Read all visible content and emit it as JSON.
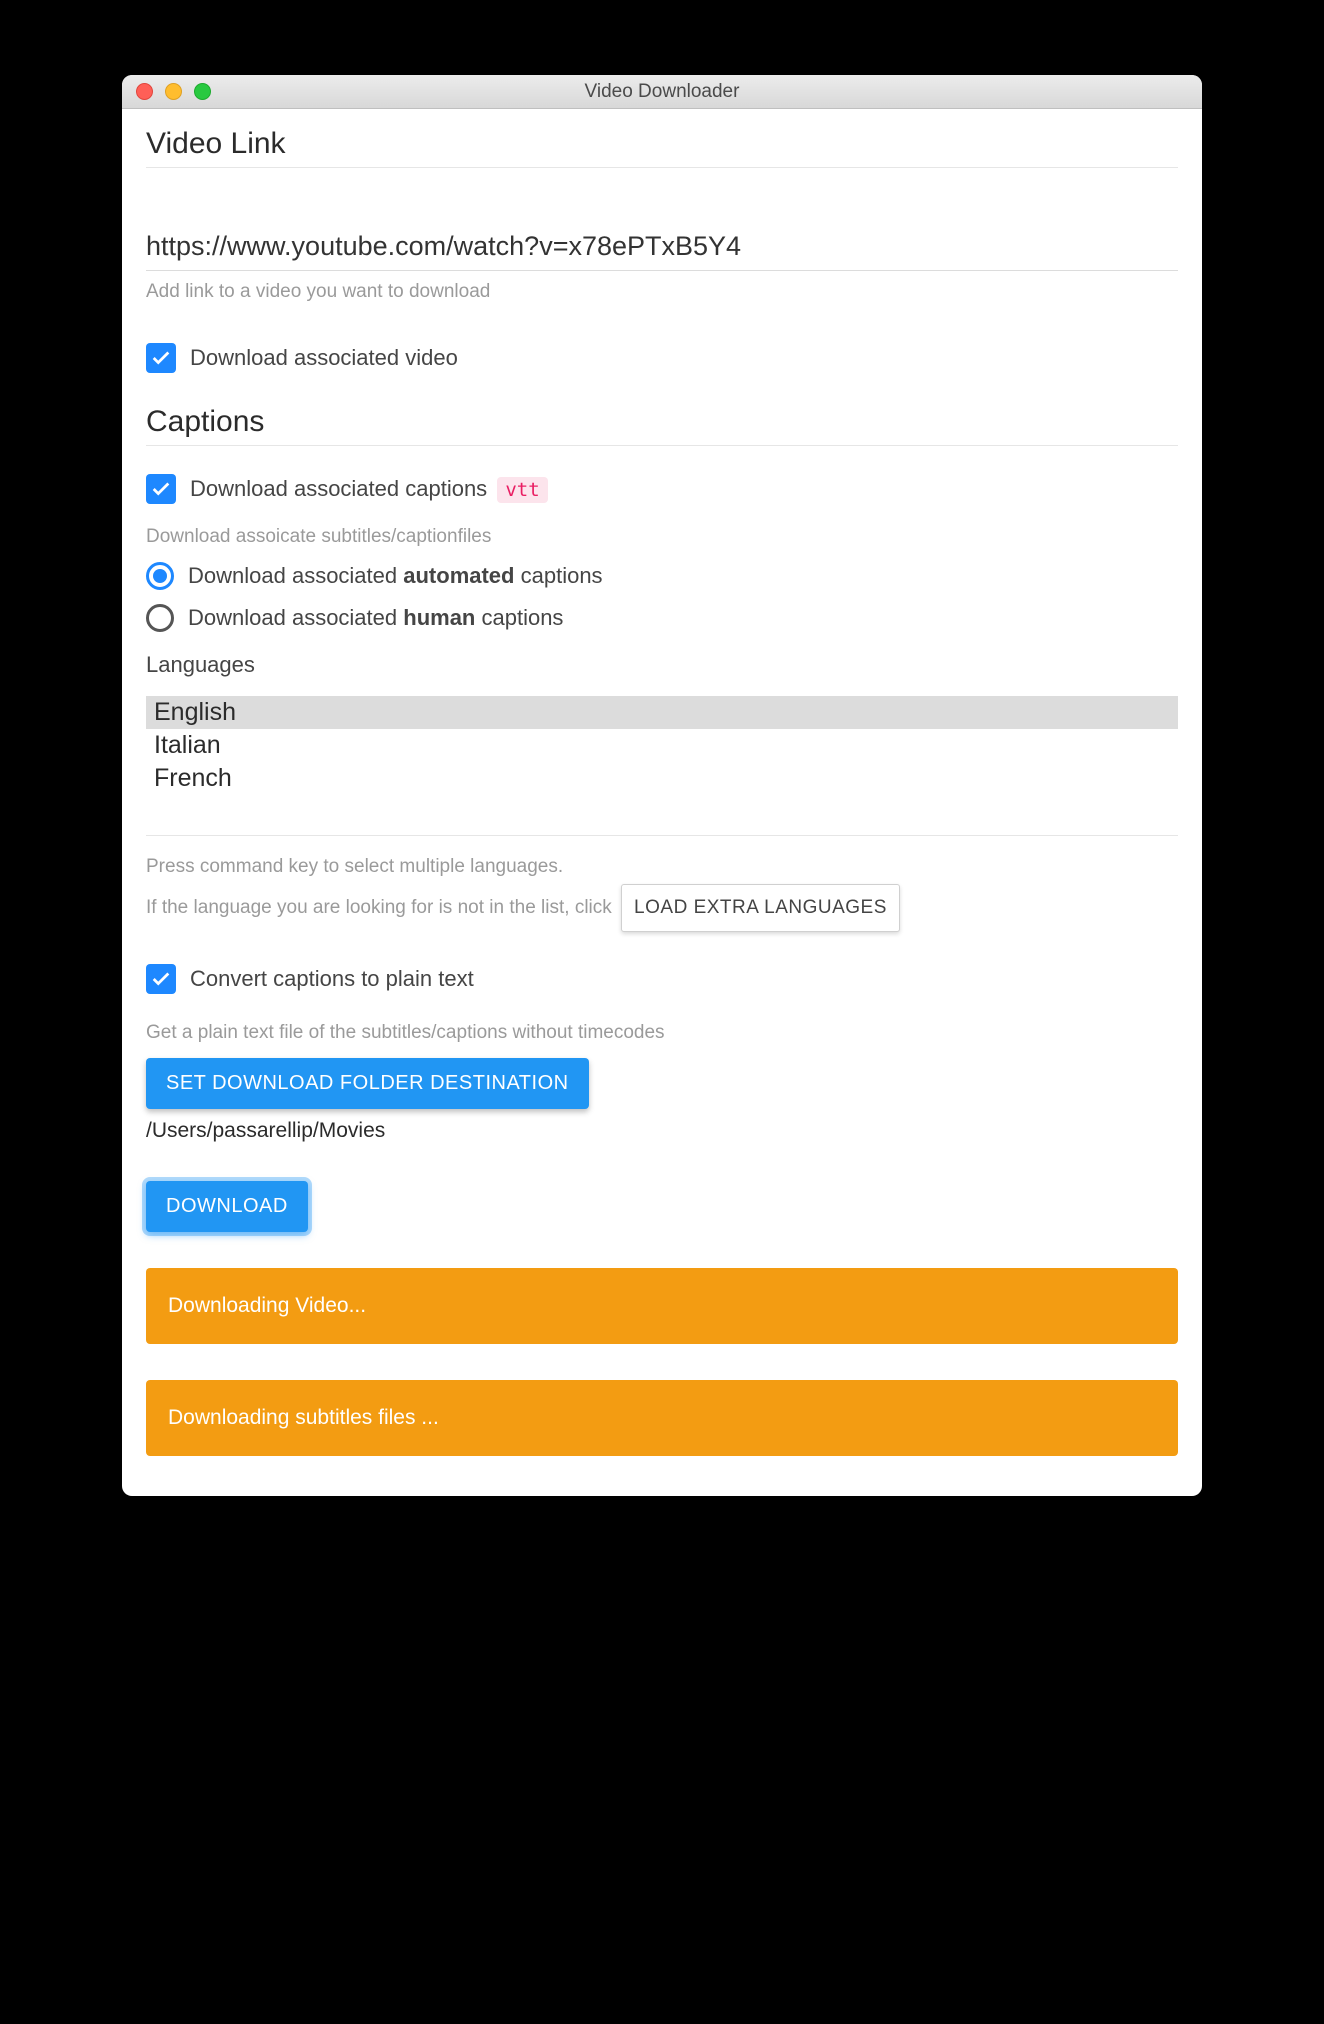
{
  "window": {
    "title": "Video Downloader"
  },
  "videoLink": {
    "heading": "Video Link",
    "url": "https://www.youtube.com/watch?v=x78ePTxB5Y4",
    "helper": "Add link to a video you want to download"
  },
  "downloadVideo": {
    "label": "Download associated video",
    "checked": true
  },
  "captions": {
    "heading": "Captions",
    "downloadCaptions": {
      "label": "Download associated captions",
      "badge": "vtt",
      "checked": true
    },
    "subhelper": "Download assoicate subtitles/captionfiles",
    "radios": {
      "automated": {
        "pre": "Download associated ",
        "bold": "automated",
        "post": " captions",
        "selected": true
      },
      "human": {
        "pre": "Download associated ",
        "bold": "human",
        "post": " captions",
        "selected": false
      }
    },
    "languagesLabel": "Languages",
    "languages": [
      {
        "name": "English",
        "selected": true
      },
      {
        "name": "Italian",
        "selected": false
      },
      {
        "name": "French",
        "selected": false
      }
    ],
    "langHelp1": "Press command key to select multiple languages.",
    "langHelp2": "If the language you are looking for is not in the list, click",
    "loadExtraBtn": "LOAD EXTRA LANGUAGES",
    "convertPlain": {
      "label": "Convert captions to plain text",
      "checked": true,
      "helper": "Get a plain text file of the subtitles/captions without timecodes"
    }
  },
  "destination": {
    "button": "SET DOWNLOAD FOLDER DESTINATION",
    "path": "/Users/passarellip/Movies"
  },
  "downloadBtn": "DOWNLOAD",
  "status": {
    "video": "Downloading Video...",
    "subs": "Downloading subtitles files ..."
  }
}
